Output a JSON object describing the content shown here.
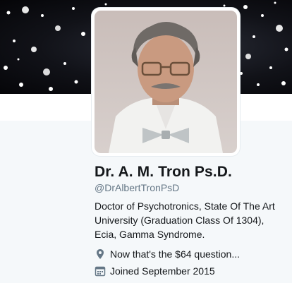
{
  "profile": {
    "display_name": "Dr. A. M. Tron Ps.D.",
    "handle": "@DrAlbertTronPsD",
    "bio": "Doctor of Psychotronics, State Of The Art University (Graduation Class Of 1304), Ecia, Gamma Syndrome.",
    "location": "Now that's the $64 question...",
    "joined": "Joined September 2015"
  },
  "icons": {
    "location": "location-pin-icon",
    "joined": "calendar-icon"
  },
  "colors": {
    "name": "#14171a",
    "handle": "#657786",
    "page_background": "#f5f8fa",
    "banner": "#111218"
  }
}
